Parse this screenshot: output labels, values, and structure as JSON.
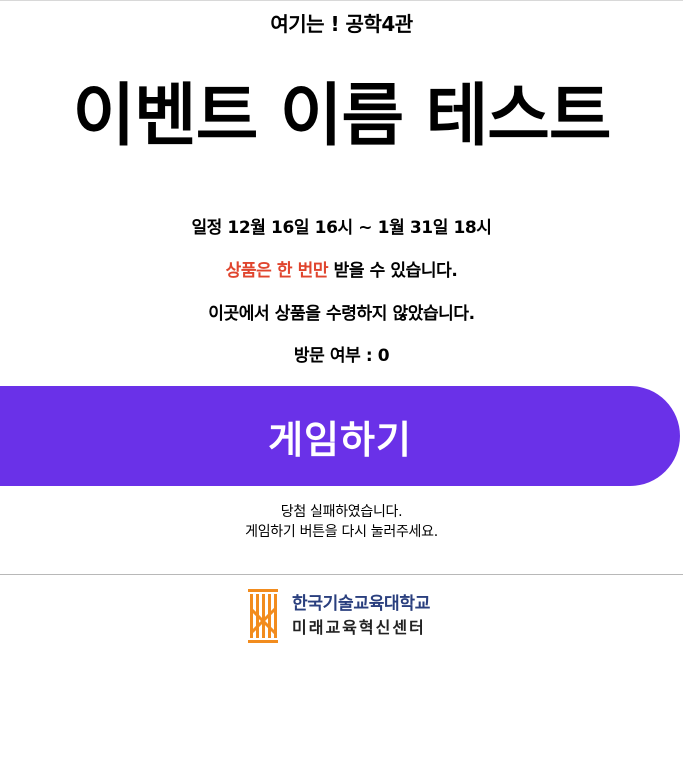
{
  "header": {
    "location": "여기는 ! 공학4관"
  },
  "event": {
    "title": "이벤트 이름 테스트"
  },
  "info": {
    "schedule": "일정 12월 16일 16시 ~ 1월 31일 18시",
    "once_highlight": "상품은 한 번만",
    "once_rest": " 받을 수 있습니다.",
    "received": "이곳에서 상품을 수령하지 않았습니다.",
    "visit": "방문 여부 : 0"
  },
  "play_button": {
    "label": "게임하기"
  },
  "result": {
    "line1": "당첨 실패하였습니다.",
    "line2": "게임하기 버튼을 다시 눌러주세요."
  },
  "footer": {
    "logo_line1": "한국기술교육대학교",
    "logo_line2": "미래교육혁신센터",
    "logo_icon": "koreatech-emblem"
  },
  "colors": {
    "button": "#6a31e8",
    "highlight": "#e0452e",
    "emblem_orange": "#f28c1e"
  }
}
